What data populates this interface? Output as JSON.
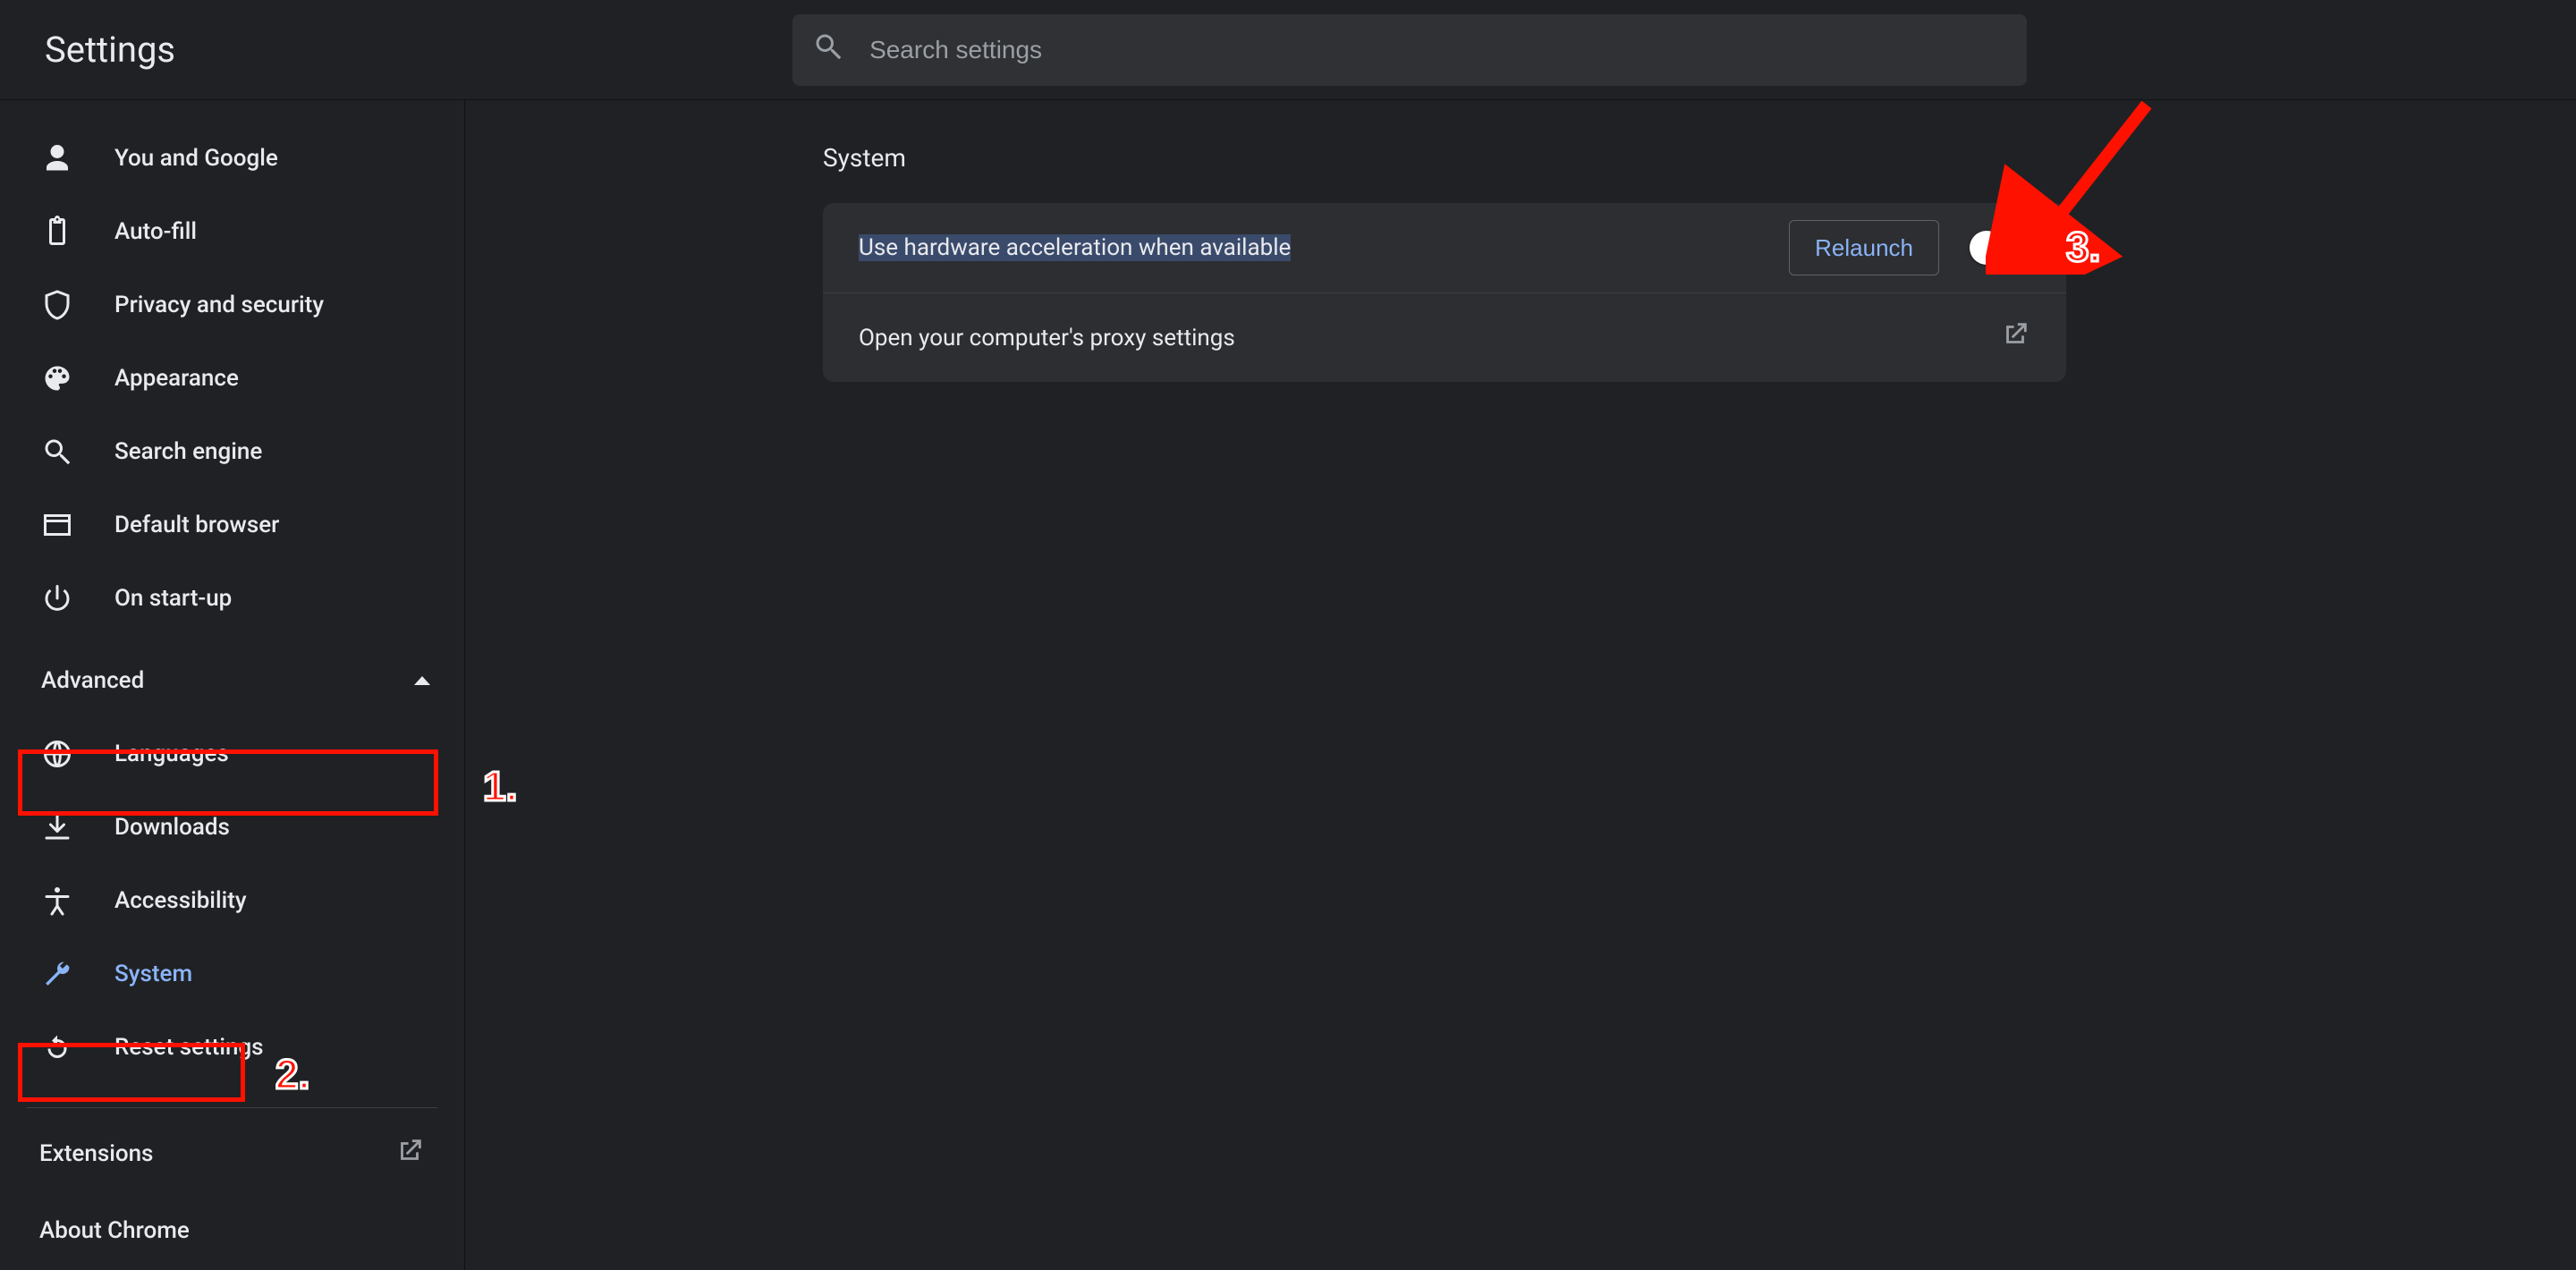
{
  "app": {
    "title": "Settings"
  },
  "search": {
    "placeholder": "Search settings"
  },
  "sidebar": {
    "primary": [
      {
        "label": "You and Google",
        "icon": "person"
      },
      {
        "label": "Auto-fill",
        "icon": "clipboard"
      },
      {
        "label": "Privacy and security",
        "icon": "shield"
      },
      {
        "label": "Appearance",
        "icon": "palette"
      },
      {
        "label": "Search engine",
        "icon": "search"
      },
      {
        "label": "Default browser",
        "icon": "window"
      },
      {
        "label": "On start-up",
        "icon": "power"
      }
    ],
    "advanced_label": "Advanced",
    "advanced_expanded": true,
    "advanced": [
      {
        "label": "Languages",
        "icon": "globe"
      },
      {
        "label": "Downloads",
        "icon": "download"
      },
      {
        "label": "Accessibility",
        "icon": "accessibility"
      },
      {
        "label": "System",
        "icon": "wrench",
        "selected": true
      },
      {
        "label": "Reset settings",
        "icon": "reset"
      }
    ],
    "footer": [
      {
        "label": "Extensions",
        "external": true
      },
      {
        "label": "About Chrome",
        "external": false
      }
    ]
  },
  "main": {
    "section_title": "System",
    "rows": [
      {
        "label": "Use hardware acceleration when available",
        "highlighted": true,
        "relaunch_label": "Relaunch",
        "toggle_on": false
      },
      {
        "label": "Open your computer's proxy settings",
        "external": true
      }
    ]
  },
  "annotations": {
    "n1": "1.",
    "n2": "2.",
    "n3": "3."
  }
}
